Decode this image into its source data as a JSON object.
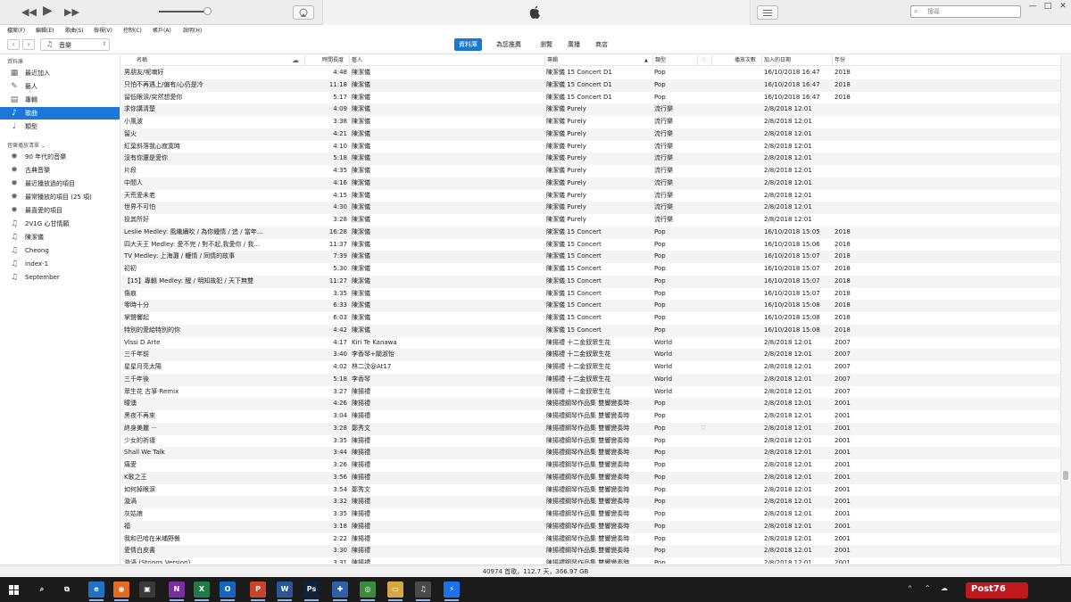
{
  "toolbar": {
    "prev": "◀◀",
    "play": "▶",
    "next": "▶▶",
    "search_placeholder": "搜尋",
    "win_min": "—",
    "win_max": "□",
    "win_close": "✕"
  },
  "menubar": [
    "檔案(F)",
    "編輯(E)",
    "歌曲(S)",
    "檢視(V)",
    "控制(C)",
    "帳戶(A)",
    "說明(H)"
  ],
  "nav": {
    "media_label": "音樂",
    "tabs": [
      {
        "label": "資料庫",
        "selected": true
      },
      {
        "label": "為您推薦",
        "selected": false
      },
      {
        "label": "瀏覽",
        "selected": false
      },
      {
        "label": "廣播",
        "selected": false
      },
      {
        "label": "商店",
        "selected": false
      }
    ]
  },
  "sidebar": {
    "library_header": "資料庫",
    "library_items": [
      {
        "label": "最近加入",
        "icon": "grid-icon"
      },
      {
        "label": "藝人",
        "icon": "microphone-icon"
      },
      {
        "label": "專輯",
        "icon": "album-icon"
      },
      {
        "label": "歌曲",
        "icon": "music-note-icon",
        "selected": true
      },
      {
        "label": "類型",
        "icon": "genre-icon"
      }
    ],
    "playlists_header": "音樂播放清單 ⌄",
    "playlists": [
      {
        "label": "90 年代的音樂",
        "icon": "gear-icon"
      },
      {
        "label": "古典音樂",
        "icon": "gear-icon"
      },
      {
        "label": "最近播放過的項目",
        "icon": "gear-icon"
      },
      {
        "label": "最常播放的項目 (25 項)",
        "icon": "gear-icon"
      },
      {
        "label": "最喜愛的項目",
        "icon": "gear-icon"
      },
      {
        "label": "2V1G 心甘情願",
        "icon": "playlist-icon"
      },
      {
        "label": "陳潔儀",
        "icon": "playlist-icon"
      },
      {
        "label": "Cheong",
        "icon": "playlist-icon"
      },
      {
        "label": "index-1",
        "icon": "playlist-icon"
      },
      {
        "label": "September",
        "icon": "playlist-icon"
      }
    ]
  },
  "columns": {
    "name": "名稱",
    "time": "時間長度",
    "artist": "藝人",
    "album": "專輯",
    "genre": "類型",
    "heart": "♡",
    "plays": "播放次數",
    "added": "加入的日期",
    "year": "年份",
    "cloud": "☁",
    "sort": "▲"
  },
  "songs": [
    {
      "name": "男朋友/呢喃好",
      "time": "4:48",
      "artist": "陳潔儀",
      "album": "陳潔儀 15 Concert D1",
      "genre": "Pop",
      "heart": "",
      "added": "16/10/2018 16:47",
      "year": "2018"
    },
    {
      "name": "只怕不再遇上/偏有/心仍是冷",
      "time": "11:18",
      "artist": "陳潔儀",
      "album": "陳潔儀 15 Concert D1",
      "genre": "Pop",
      "heart": "",
      "added": "16/10/2018 16:47",
      "year": "2018"
    },
    {
      "name": "留低眼淚/突然想愛你",
      "time": "5:17",
      "artist": "陳潔儀",
      "album": "陳潔儀 15 Concert D1",
      "genre": "Pop",
      "heart": "",
      "added": "16/10/2018 16:47",
      "year": "2018"
    },
    {
      "name": "求你講清楚",
      "time": "4:09",
      "artist": "陳潔儀",
      "album": "陳潔儀 Purely",
      "genre": "流行樂",
      "heart": "",
      "added": "2/8/2018 12:01",
      "year": ""
    },
    {
      "name": "小風波",
      "time": "3:38",
      "artist": "陳潔儀",
      "album": "陳潔儀 Purely",
      "genre": "流行樂",
      "heart": "",
      "added": "2/8/2018 12:01",
      "year": ""
    },
    {
      "name": "留火",
      "time": "4:21",
      "artist": "陳潔儀",
      "album": "陳潔儀 Purely",
      "genre": "流行樂",
      "heart": "",
      "added": "2/8/2018 12:01",
      "year": ""
    },
    {
      "name": "紅葉斜落我心寂寞時",
      "time": "4:10",
      "artist": "陳潔儀",
      "album": "陳潔儀 Purely",
      "genre": "流行樂",
      "heart": "",
      "added": "2/8/2018 12:01",
      "year": ""
    },
    {
      "name": "沒有你還是愛你",
      "time": "5:18",
      "artist": "陳潔儀",
      "album": "陳潔儀 Purely",
      "genre": "流行樂",
      "heart": "",
      "added": "2/8/2018 12:01",
      "year": ""
    },
    {
      "name": "片段",
      "time": "4:35",
      "artist": "陳潔儀",
      "album": "陳潔儀 Purely",
      "genre": "流行樂",
      "heart": "",
      "added": "2/8/2018 12:01",
      "year": ""
    },
    {
      "name": "中間人",
      "time": "4:16",
      "artist": "陳潔儀",
      "album": "陳潔儀 Purely",
      "genre": "流行樂",
      "heart": "",
      "added": "2/8/2018 12:01",
      "year": ""
    },
    {
      "name": "天荒愛未老",
      "time": "4:15",
      "artist": "陳潔儀",
      "album": "陳潔儀 Purely",
      "genre": "流行樂",
      "heart": "",
      "added": "2/8/2018 12:01",
      "year": ""
    },
    {
      "name": "世界不可怕",
      "time": "4:30",
      "artist": "陳潔儀",
      "album": "陳潔儀 Purely",
      "genre": "流行樂",
      "heart": "",
      "added": "2/8/2018 12:01",
      "year": ""
    },
    {
      "name": "投其所好",
      "time": "3:28",
      "artist": "陳潔儀",
      "album": "陳潔儀 Purely",
      "genre": "流行樂",
      "heart": "",
      "added": "2/8/2018 12:01",
      "year": ""
    },
    {
      "name": "Leslie Medley: 風繼續吹 / 為你鍾情 / 追 / 當年...",
      "time": "16:28",
      "artist": "陳潔儀",
      "album": "陳潔儀 15 Concert",
      "genre": "Pop",
      "heart": "",
      "added": "16/10/2018 15:05",
      "year": "2018"
    },
    {
      "name": "四大天王 Medley: 愛不完 / 對不起,我愛你 / 我...",
      "time": "11:37",
      "artist": "陳潔儀",
      "album": "陳潔儀 15 Concert",
      "genre": "Pop",
      "heart": "",
      "added": "16/10/2018 15:06",
      "year": "2018"
    },
    {
      "name": "TV Medley: 上海灘 / 轆情 / 同情的故事",
      "time": "7:39",
      "artist": "陳潔儀",
      "album": "陳潔儀 15 Concert",
      "genre": "Pop",
      "heart": "",
      "added": "16/10/2018 15:07",
      "year": "2018"
    },
    {
      "name": "初初",
      "time": "5:30",
      "artist": "陳潔儀",
      "album": "陳潔儀 15 Concert",
      "genre": "Pop",
      "heart": "",
      "added": "16/10/2018 15:07",
      "year": "2018"
    },
    {
      "name": "【15】專輯 Medley: 醒 / 明知故犯 / 天下無雙",
      "time": "11:27",
      "artist": "陳潔儀",
      "album": "陳潔儀 15 Concert",
      "genre": "Pop",
      "heart": "",
      "added": "16/10/2018 15:07",
      "year": "2018"
    },
    {
      "name": "傷痕",
      "time": "3:35",
      "artist": "陳潔儀",
      "album": "陳潔儀 15 Concert",
      "genre": "Pop",
      "heart": "",
      "added": "16/10/2018 15:07",
      "year": "2018"
    },
    {
      "name": "零時十分",
      "time": "6:33",
      "artist": "陳潔儀",
      "album": "陳潔儀 15 Concert",
      "genre": "Pop",
      "heart": "",
      "added": "16/10/2018 15:08",
      "year": "2018"
    },
    {
      "name": "掌聲響起",
      "time": "6:03",
      "artist": "陳潔儀",
      "album": "陳潔儀 15 Concert",
      "genre": "Pop",
      "heart": "",
      "added": "16/10/2018 15:08",
      "year": "2018"
    },
    {
      "name": "特別的愛給特別的你",
      "time": "4:42",
      "artist": "陳潔儀",
      "album": "陳潔儀 15 Concert",
      "genre": "Pop",
      "heart": "",
      "added": "16/10/2018 15:08",
      "year": "2018"
    },
    {
      "name": "Vissi D Arte",
      "time": "4:17",
      "artist": "Kiri Te Kanawa",
      "album": "陳揚禮 十二金釵眾生花",
      "genre": "World",
      "heart": "",
      "added": "2/8/2018 12:01",
      "year": "2007"
    },
    {
      "name": "三千年前",
      "time": "3:40",
      "artist": "李香琴+關淑怡",
      "album": "陳揚禮 十二金釵眾生花",
      "genre": "World",
      "heart": "",
      "added": "2/8/2018 12:01",
      "year": "2007"
    },
    {
      "name": "星星月亮太陽",
      "time": "4:02",
      "artist": "林二汶@At17",
      "album": "陳揚禮 十二金釵眾生花",
      "genre": "World",
      "heart": "",
      "added": "2/8/2018 12:01",
      "year": "2007"
    },
    {
      "name": "三千年後",
      "time": "5:18",
      "artist": "李香琴",
      "album": "陳揚禮 十二金釵眾生花",
      "genre": "World",
      "heart": "",
      "added": "2/8/2018 12:01",
      "year": "2007"
    },
    {
      "name": "眾生花 古箏 Remix",
      "time": "3:27",
      "artist": "陳揚禮",
      "album": "陳揚禮 十二金釵眾生花",
      "genre": "World",
      "heart": "",
      "added": "2/8/2018 12:01",
      "year": "2007"
    },
    {
      "name": "瞳湧",
      "time": "4:26",
      "artist": "陳揚禮",
      "album": "陳揚禮鋼琴作品集 雙響變奏時",
      "genre": "Pop",
      "heart": "",
      "added": "2/8/2018 12:01",
      "year": "2001"
    },
    {
      "name": "黑夜不再來",
      "time": "3:04",
      "artist": "陳揚禮",
      "album": "陳揚禮鋼琴作品集 雙響變奏時",
      "genre": "Pop",
      "heart": "",
      "added": "2/8/2018 12:01",
      "year": "2001"
    },
    {
      "name": "終身美麗 ···",
      "time": "3:28",
      "artist": "鄭秀文",
      "album": "陳揚禮鋼琴作品集 雙響變奏時",
      "genre": "Pop",
      "heart": "♡",
      "added": "2/8/2018 12:01",
      "year": "2001"
    },
    {
      "name": "少女的祈禱",
      "time": "3:35",
      "artist": "陳揚禮",
      "album": "陳揚禮鋼琴作品集 雙響變奏時",
      "genre": "Pop",
      "heart": "",
      "added": "2/8/2018 12:01",
      "year": "2001"
    },
    {
      "name": "Shall We Talk",
      "time": "3:44",
      "artist": "陳揚禮",
      "album": "陳揚禮鋼琴作品集 雙響變奏時",
      "genre": "Pop",
      "heart": "",
      "added": "2/8/2018 12:01",
      "year": "2001"
    },
    {
      "name": "痛愛",
      "time": "3:26",
      "artist": "陳揚禮",
      "album": "陳揚禮鋼琴作品集 雙響變奏時",
      "genre": "Pop",
      "heart": "",
      "added": "2/8/2018 12:01",
      "year": "2001"
    },
    {
      "name": "K歌之王",
      "time": "3:56",
      "artist": "陳揚禮",
      "album": "陳揚禮鋼琴作品集 雙響變奏時",
      "genre": "Pop",
      "heart": "",
      "added": "2/8/2018 12:01",
      "year": "2001"
    },
    {
      "name": "如何掉眼淚",
      "time": "3:54",
      "artist": "鄭秀文",
      "album": "陳揚禮鋼琴作品集 雙響變奏時",
      "genre": "Pop",
      "heart": "",
      "added": "2/8/2018 12:01",
      "year": "2001"
    },
    {
      "name": "漩渦",
      "time": "3:32",
      "artist": "陳揚禮",
      "album": "陳揚禮鋼琴作品集 雙響變奏時",
      "genre": "Pop",
      "heart": "",
      "added": "2/8/2018 12:01",
      "year": "2001"
    },
    {
      "name": "灰姑娘",
      "time": "3:35",
      "artist": "陳揚禮",
      "album": "陳揚禮鋼琴作品集 雙響變奏時",
      "genre": "Pop",
      "heart": "",
      "added": "2/8/2018 12:01",
      "year": "2001"
    },
    {
      "name": "福",
      "time": "3:18",
      "artist": "陳揚禮",
      "album": "陳揚禮鋼琴作品集 雙響變奏時",
      "genre": "Pop",
      "heart": "",
      "added": "2/8/2018 12:01",
      "year": "2001"
    },
    {
      "name": "我和巴哈在米埔野餐",
      "time": "2:22",
      "artist": "陳揚禮",
      "album": "陳揚禮鋼琴作品集 雙響變奏時",
      "genre": "Pop",
      "heart": "",
      "added": "2/8/2018 12:01",
      "year": "2001"
    },
    {
      "name": "愛情白皮書",
      "time": "3:30",
      "artist": "陳揚禮",
      "album": "陳揚禮鋼琴作品集 雙響變奏時",
      "genre": "Pop",
      "heart": "",
      "added": "2/8/2018 12:01",
      "year": "2001"
    },
    {
      "name": "漩渦 (Strings Version)",
      "time": "3:31",
      "artist": "陳揚禮",
      "album": "陳揚禮鋼琴作品集 雙響變奏時",
      "genre": "Pop",
      "heart": "",
      "added": "2/8/2018 12:01",
      "year": "2001"
    }
  ],
  "status": "40974 首歌，112.7 天，366.97 GB",
  "taskbar": {
    "apps": [
      {
        "name": "search-icon",
        "glyph": "⌕",
        "color": "#1b1b1b"
      },
      {
        "name": "task-view-icon",
        "glyph": "⧉",
        "color": "#1b1b1b"
      },
      {
        "name": "edge-icon",
        "glyph": "e",
        "color": "#1e73c8"
      },
      {
        "name": "firefox-icon",
        "glyph": "◉",
        "color": "#e66a1f"
      },
      {
        "name": "store-icon",
        "glyph": "▣",
        "color": "#3a3a3a"
      },
      {
        "name": "onenote-icon",
        "glyph": "N",
        "color": "#7b2f9e"
      },
      {
        "name": "excel-icon",
        "glyph": "X",
        "color": "#1f7a45"
      },
      {
        "name": "outlook-icon",
        "glyph": "O",
        "color": "#1565c0"
      },
      {
        "name": "powerpoint-icon",
        "glyph": "P",
        "color": "#c8442a"
      },
      {
        "name": "word-icon",
        "glyph": "W",
        "color": "#2a5699"
      },
      {
        "name": "photoshop-icon",
        "glyph": "Ps",
        "color": "#0b2341"
      },
      {
        "name": "app-icon",
        "glyph": "✚",
        "color": "#2f5fa8"
      },
      {
        "name": "chrome-icon",
        "glyph": "◎",
        "color": "#3a8b3a"
      },
      {
        "name": "folder-icon",
        "glyph": "▭",
        "color": "#d8a640"
      },
      {
        "name": "itunes-icon",
        "glyph": "♫",
        "color": "#4a4a4a"
      },
      {
        "name": "messenger-icon",
        "glyph": "⚡",
        "color": "#1a73e8"
      }
    ],
    "tray_text": "Post76"
  }
}
